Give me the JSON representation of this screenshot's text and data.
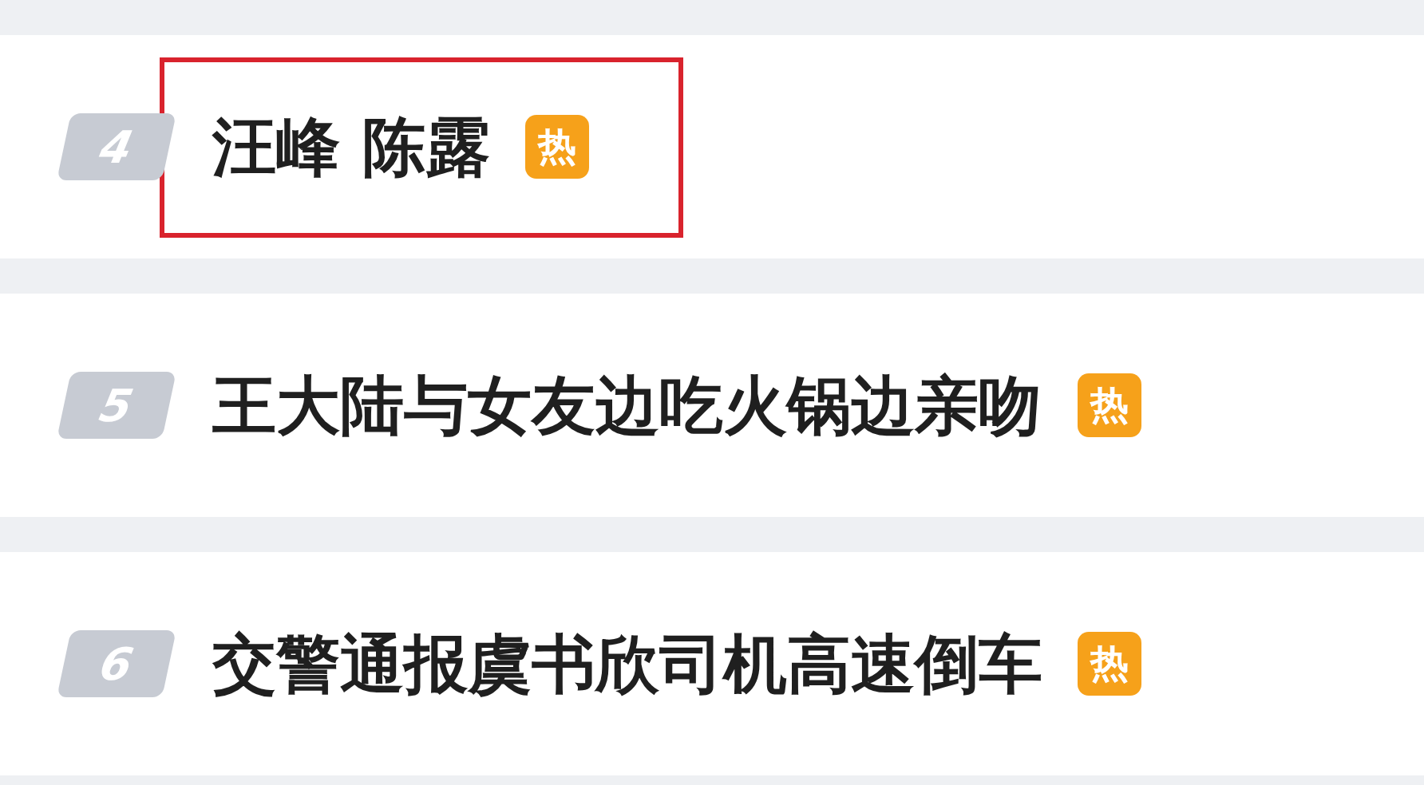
{
  "items": [
    {
      "rank": "4",
      "title": "汪峰 陈露",
      "badge": "热",
      "highlighted": true
    },
    {
      "rank": "5",
      "title": "王大陆与女友边吃火锅边亲吻",
      "badge": "热",
      "highlighted": false
    },
    {
      "rank": "6",
      "title": "交警通报虞书欣司机高速倒车",
      "badge": "热",
      "highlighted": false
    }
  ]
}
